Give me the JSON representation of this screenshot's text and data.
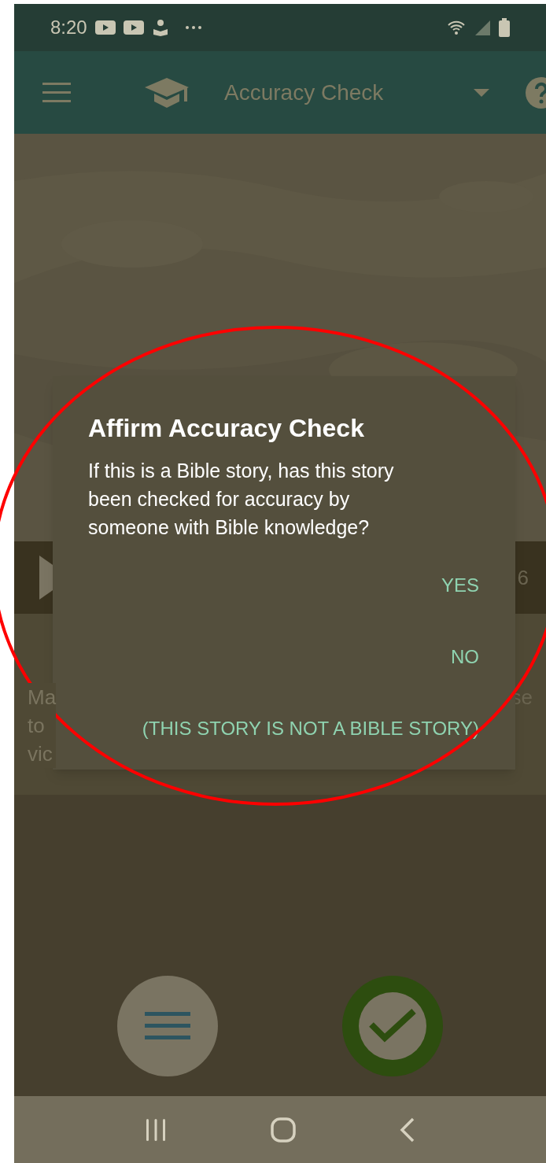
{
  "status_bar": {
    "time": "8:20"
  },
  "toolbar": {
    "title": "Accuracy Check"
  },
  "player": {
    "counter": "6"
  },
  "story_text": {
    "left_lines": [
      "Ma",
      "to",
      "vic"
    ],
    "right_lines": [
      "se"
    ]
  },
  "dialog": {
    "title": "Affirm Accuracy Check",
    "message": "If this is a Bible story, has this story been checked for accuracy by someone with Bible knowledge?",
    "buttons": [
      "YES",
      "NO",
      "(THIS STORY IS NOT A BIBLE STORY)"
    ]
  }
}
